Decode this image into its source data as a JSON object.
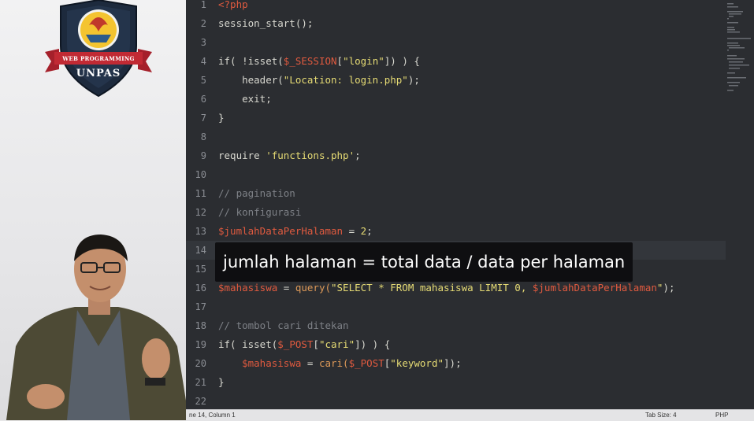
{
  "badge": {
    "line1": "WEB PROGRAMMING",
    "line2": "UNPAS"
  },
  "subtitle": "jumlah halaman = total data / data per halaman",
  "status": {
    "position": "ne 14, Column 1",
    "tab_size": "Tab Size: 4",
    "language": "PHP"
  },
  "colors": {
    "editor_bg": "#2b2d31",
    "variable": "#e05a3f",
    "string": "#e6db74",
    "comment": "#7d8086"
  },
  "code": [
    {
      "n": "1",
      "tokens": [
        {
          "t": "<?php",
          "c": "ph"
        }
      ]
    },
    {
      "n": "2",
      "tokens": [
        {
          "t": "session_start();",
          "c": ""
        }
      ]
    },
    {
      "n": "3",
      "tokens": []
    },
    {
      "n": "4",
      "tokens": [
        {
          "t": "if( !isset(",
          "c": ""
        },
        {
          "t": "$_SESSION",
          "c": "var"
        },
        {
          "t": "[",
          "c": ""
        },
        {
          "t": "\"login\"",
          "c": "str"
        },
        {
          "t": "]) ) {",
          "c": ""
        }
      ]
    },
    {
      "n": "5",
      "tokens": [
        {
          "t": "    header(",
          "c": ""
        },
        {
          "t": "\"Location: login.php\"",
          "c": "str"
        },
        {
          "t": ");",
          "c": ""
        }
      ]
    },
    {
      "n": "6",
      "tokens": [
        {
          "t": "    exit;",
          "c": ""
        }
      ]
    },
    {
      "n": "7",
      "tokens": [
        {
          "t": "}",
          "c": ""
        }
      ]
    },
    {
      "n": "8",
      "tokens": []
    },
    {
      "n": "9",
      "tokens": [
        {
          "t": "require ",
          "c": ""
        },
        {
          "t": "'functions.php'",
          "c": "str"
        },
        {
          "t": ";",
          "c": ""
        }
      ]
    },
    {
      "n": "10",
      "tokens": []
    },
    {
      "n": "11",
      "tokens": [
        {
          "t": "// pagination",
          "c": "cm"
        }
      ]
    },
    {
      "n": "12",
      "tokens": [
        {
          "t": "// konfigurasi",
          "c": "cm"
        }
      ]
    },
    {
      "n": "13",
      "tokens": [
        {
          "t": "$jumlahDataPerHalaman",
          "c": "var"
        },
        {
          "t": " = ",
          "c": ""
        },
        {
          "t": "2",
          "c": "str"
        },
        {
          "t": ";",
          "c": ""
        }
      ]
    },
    {
      "n": "14",
      "tokens": [],
      "active": true
    },
    {
      "n": "15",
      "tokens": []
    },
    {
      "n": "16",
      "tokens": [
        {
          "t": "$mahasiswa",
          "c": "var"
        },
        {
          "t": " = ",
          "c": ""
        },
        {
          "t": "query(",
          "c": "fn"
        },
        {
          "t": "\"SELECT * FROM mahasiswa LIMIT 0, ",
          "c": "str"
        },
        {
          "t": "$jumlahDataPerHalaman",
          "c": "var"
        },
        {
          "t": "\"",
          "c": "str"
        },
        {
          "t": ");",
          "c": ""
        }
      ]
    },
    {
      "n": "17",
      "tokens": []
    },
    {
      "n": "18",
      "tokens": [
        {
          "t": "// tombol cari ditekan",
          "c": "cm"
        }
      ]
    },
    {
      "n": "19",
      "tokens": [
        {
          "t": "if( isset(",
          "c": ""
        },
        {
          "t": "$_POST",
          "c": "var"
        },
        {
          "t": "[",
          "c": ""
        },
        {
          "t": "\"cari\"",
          "c": "str"
        },
        {
          "t": "]) ) {",
          "c": ""
        }
      ]
    },
    {
      "n": "20",
      "tokens": [
        {
          "t": "    ",
          "c": ""
        },
        {
          "t": "$mahasiswa",
          "c": "var"
        },
        {
          "t": " = ",
          "c": ""
        },
        {
          "t": "cari(",
          "c": "fn"
        },
        {
          "t": "$_POST",
          "c": "var"
        },
        {
          "t": "[",
          "c": ""
        },
        {
          "t": "\"keyword\"",
          "c": "str"
        },
        {
          "t": "]);",
          "c": ""
        }
      ]
    },
    {
      "n": "21",
      "tokens": [
        {
          "t": "}",
          "c": ""
        }
      ]
    },
    {
      "n": "22",
      "tokens": []
    }
  ]
}
